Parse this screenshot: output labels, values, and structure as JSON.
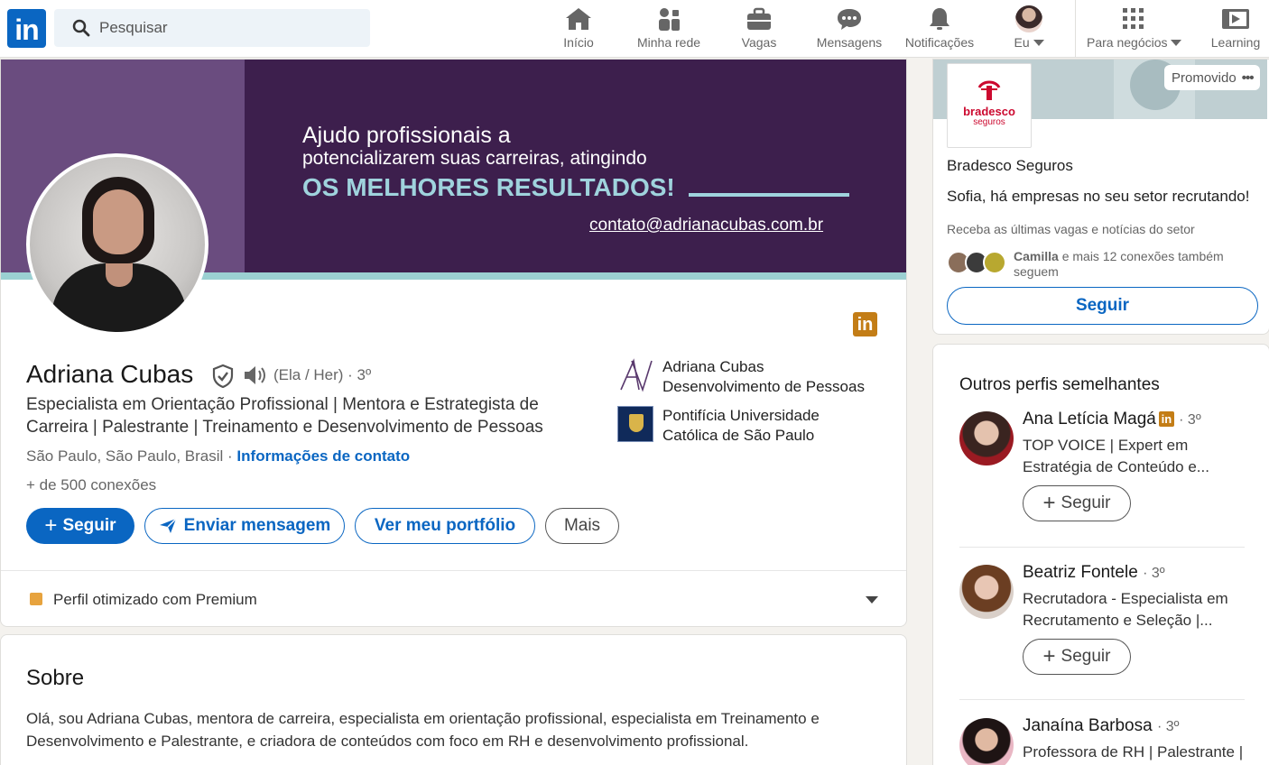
{
  "nav": {
    "logo": "in",
    "search_placeholder": "Pesquisar",
    "items": [
      {
        "label": "Início",
        "icon": "home-icon"
      },
      {
        "label": "Minha rede",
        "icon": "network-icon"
      },
      {
        "label": "Vagas",
        "icon": "briefcase-icon"
      },
      {
        "label": "Mensagens",
        "icon": "messaging-icon"
      },
      {
        "label": "Notificações",
        "icon": "bell-icon"
      },
      {
        "label": "Eu",
        "icon": "avatar"
      },
      {
        "label": "Para negócios",
        "icon": "grid-icon"
      },
      {
        "label": "Learning",
        "icon": "learning-icon"
      }
    ]
  },
  "banner": {
    "line1": "Ajudo profissionais a",
    "line2": "potencializarem suas carreiras, atingindo",
    "line3": "OS MELHORES RESULTADOS!",
    "email": "contato@adrianacubas.com.br"
  },
  "profile": {
    "name": "Adriana Cubas",
    "pronouns": "(Ela / Her) · 3º",
    "headline": "Especialista em Orientação Profissional | Mentora e Estrategista de Carreira | Palestrante | Treinamento e Desenvolvimento de Pessoas",
    "location": "São Paulo, São Paulo, Brasil",
    "location_sep": " · ",
    "contact_link": "Informações de contato",
    "connections": "+ de 500 conexões",
    "orgs": [
      {
        "line1": "Adriana Cubas",
        "line2": "Desenvolvimento de Pessoas"
      },
      {
        "line1": "Pontifícia Universidade",
        "line2": "Católica de São Paulo"
      }
    ],
    "buttons": {
      "follow": "Seguir",
      "message": "Enviar mensagem",
      "portfolio": "Ver meu portfólio",
      "more": "Mais"
    },
    "premium_text": "Perfil otimizado com Premium"
  },
  "about": {
    "title": "Sobre",
    "body": "Olá, sou Adriana Cubas, mentora de carreira, especialista em orientação profissional, especialista em Treinamento e Desenvolvimento e Palestrante, e criadora de conteúdos com foco em RH e desenvolvimento profissional."
  },
  "ad": {
    "promoted": "Promovido",
    "logo_text": "bradesco",
    "logo_sub": "seguros",
    "company": "Bradesco Seguros",
    "message": "Sofia, há empresas no seu setor recrutando!",
    "sub": "Receba as últimas vagas e notícias do setor",
    "conn_name": "Camilla",
    "conn_rest": " e mais 12 conexões também seguem",
    "button": "Seguir"
  },
  "similar": {
    "title": "Outros perfis semelhantes",
    "follow_label": "Seguir",
    "people": [
      {
        "name": "Ana Letícia Magá",
        "degree": "· 3º",
        "headline": "TOP VOICE | Expert em Estratégia de Conteúdo e..."
      },
      {
        "name": "Beatriz Fontele",
        "degree": "· 3º",
        "headline": "Recrutadora - Especialista em Recrutamento e Seleção |..."
      },
      {
        "name": "Janaína Barbosa",
        "degree": "· 3º",
        "headline": "Professora de RH | Palestrante |"
      }
    ]
  },
  "colors": {
    "brand": "#0a66c2",
    "banner": "#3d1f4d",
    "accent": "#9fd3dd",
    "premium": "#c37d16"
  }
}
